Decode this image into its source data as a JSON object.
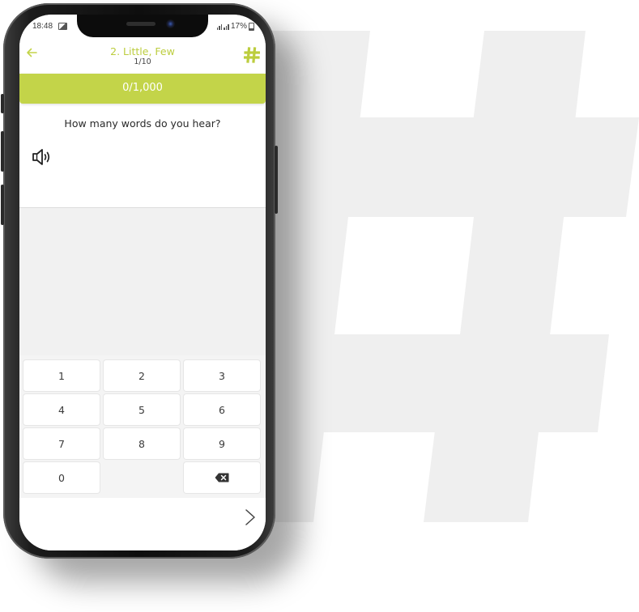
{
  "status": {
    "time": "18:48",
    "battery": "17%"
  },
  "header": {
    "title": "2. Little, Few",
    "progress": "1/10",
    "back_icon": "arrow-left-icon",
    "menu_icon": "hash-icon"
  },
  "score": {
    "text": "0/1,000"
  },
  "question": {
    "prompt": "How many words do you hear?",
    "audio_icon": "speaker-icon"
  },
  "answer": {
    "value": ""
  },
  "keypad": {
    "keys": [
      "1",
      "2",
      "3",
      "4",
      "5",
      "6",
      "7",
      "8",
      "9",
      "0",
      "",
      "backspace"
    ]
  },
  "footer": {
    "next_icon": "chevron-right-icon"
  },
  "colors": {
    "accent": "#c3d449",
    "background_hash": "#efefef"
  }
}
